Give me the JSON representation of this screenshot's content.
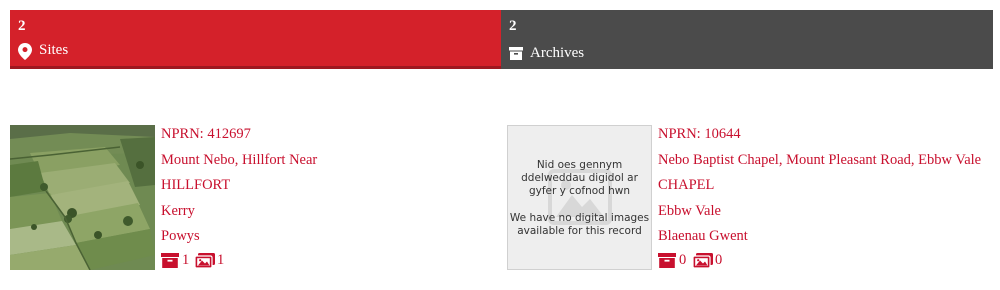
{
  "tabs": [
    {
      "count": "2",
      "label": "Sites",
      "icon": "map-pin-icon",
      "color": "#d4212a"
    },
    {
      "count": "2",
      "label": "Archives",
      "icon": "archive-box-icon",
      "color": "#4b4b4b"
    }
  ],
  "results": [
    {
      "nprn": "NPRN: 412697",
      "name": "Mount Nebo, Hillfort Near",
      "type": "HILLFORT",
      "community": "Kerry",
      "county": "Powys",
      "archive_count": "1",
      "image_count": "1",
      "thumbnail": "aerial-photo-fields"
    },
    {
      "nprn": "NPRN: 10644",
      "name": "Nebo Baptist Chapel, Mount Pleasant Road, Ebbw Vale",
      "type": "CHAPEL",
      "community": "Ebbw Vale",
      "county": "Blaenau Gwent",
      "archive_count": "0",
      "image_count": "0",
      "placeholder_cy": "Nid oes gennym ddelweddau digidol ar gyfer y cofnod hwn",
      "placeholder_en": "We have no digital images available for this record"
    }
  ],
  "colors": {
    "accent": "#c8102e",
    "tab_active": "#d4212a",
    "tab_inactive": "#4b4b4b"
  }
}
